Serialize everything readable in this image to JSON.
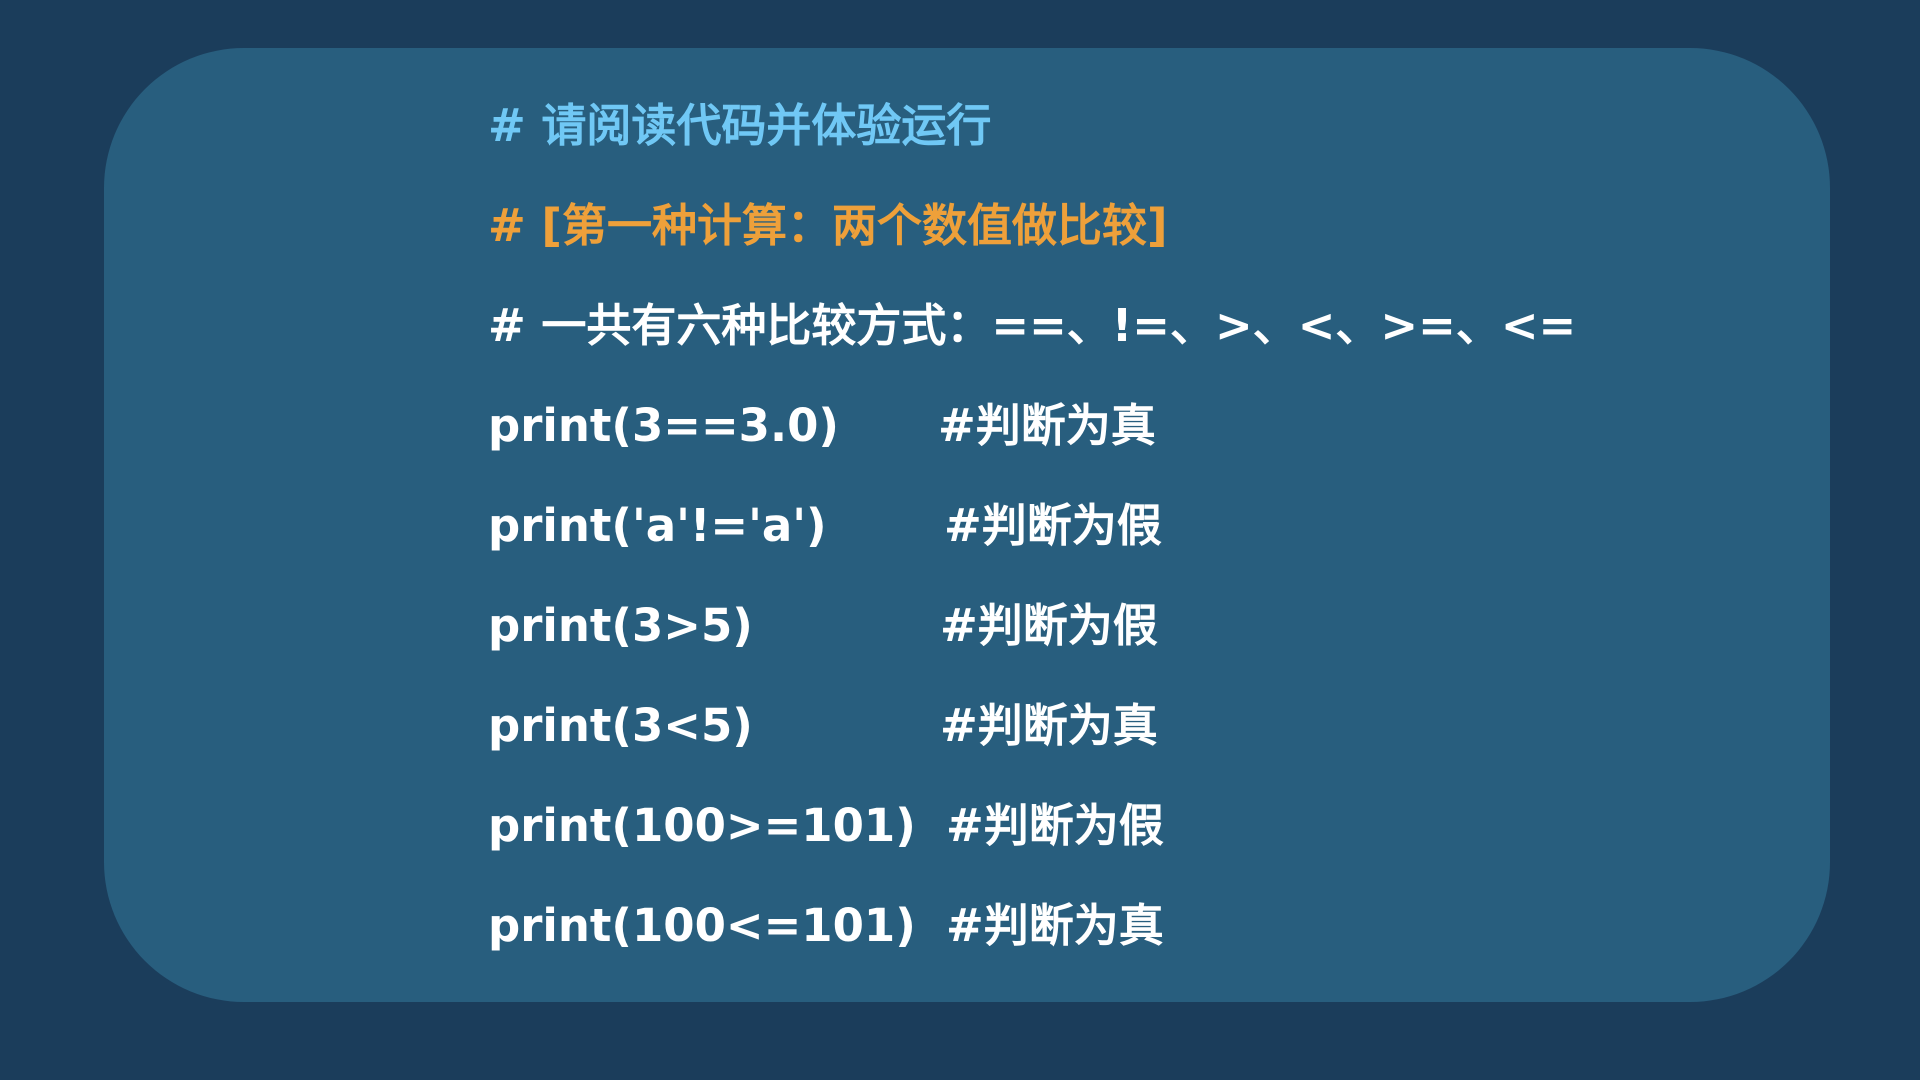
{
  "header": {
    "title": "# 请阅读代码并体验运行",
    "section": "# [第一种计算：两个数值做比较]",
    "note": "# 一共有六种比较方式：==、!=、>、<、>=、<="
  },
  "lines": [
    {
      "code": "print(3==3.0)",
      "comment": "#判断为真"
    },
    {
      "code": "print('a'!='a')",
      "comment": "#判断为假"
    },
    {
      "code": "print(3>5)",
      "comment": "#判断为假"
    },
    {
      "code": "print(3<5)",
      "comment": "#判断为真"
    },
    {
      "code": "print(100>=101)",
      "comment": "#判断为假"
    },
    {
      "code": "print(100<=101)",
      "comment": "#判断为真"
    }
  ],
  "colors": {
    "background": "#1b3d5b",
    "card": "#285e7e",
    "title": "#70c8f5",
    "section": "#eea03a",
    "text": "#ffffff"
  }
}
